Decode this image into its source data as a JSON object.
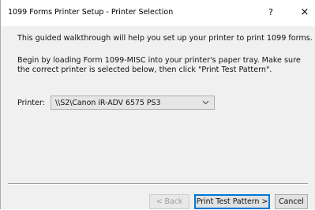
{
  "window": {
    "title": "1099 Forms Printer Setup - Printer Selection",
    "help_glyph": "?",
    "close_glyph": "×"
  },
  "content": {
    "intro": "This guided walkthrough will help you set up your printer to print 1099 forms.",
    "instructions": "Begin by loading Form 1099-MISC into your printer's paper tray. Make sure the correct printer is selected below, then click \"Print Test Pattern\".",
    "printer_label": "Printer:",
    "printer_value": "\\\\S2\\Canon iR-ADV 6575 PS3"
  },
  "buttons": {
    "back": "< Back",
    "next": "Print Test Pattern >",
    "cancel": "Cancel"
  },
  "colors": {
    "dialog_bg": "#f0f0f0",
    "default_button_border": "#0078d7"
  }
}
